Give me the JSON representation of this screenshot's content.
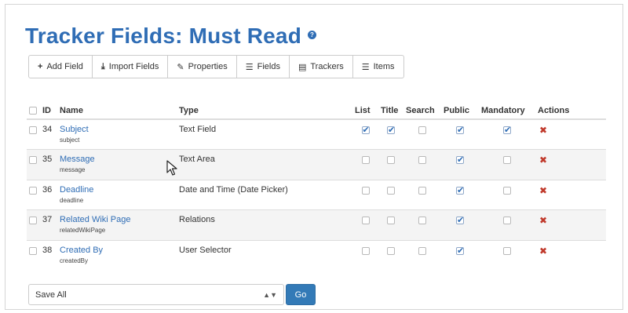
{
  "page": {
    "title": "Tracker Fields: Must Read",
    "help_icon": "?"
  },
  "toolbar": {
    "buttons": [
      {
        "label": "Add Field",
        "icon": "plus-icon",
        "glyph": "+"
      },
      {
        "label": "Import Fields",
        "icon": "import-icon",
        "glyph": "⤓"
      },
      {
        "label": "Properties",
        "icon": "wrench-icon",
        "glyph": "✎"
      },
      {
        "label": "Fields",
        "icon": "list-icon",
        "glyph": "☰"
      },
      {
        "label": "Trackers",
        "icon": "database-icon",
        "glyph": "▤"
      },
      {
        "label": "Items",
        "icon": "list-icon",
        "glyph": "☰"
      }
    ]
  },
  "table": {
    "headers": {
      "id": "ID",
      "name": "Name",
      "type": "Type",
      "list": "List",
      "title": "Title",
      "search": "Search",
      "public": "Public",
      "mandatory": "Mandatory",
      "actions": "Actions"
    },
    "rows": [
      {
        "id": "34",
        "name": "Subject",
        "perm": "subject",
        "type": "Text Field",
        "list": true,
        "title": true,
        "search": false,
        "public": true,
        "mandatory": true
      },
      {
        "id": "35",
        "name": "Message",
        "perm": "message",
        "type": "Text Area",
        "list": false,
        "title": false,
        "search": false,
        "public": true,
        "mandatory": false
      },
      {
        "id": "36",
        "name": "Deadline",
        "perm": "deadline",
        "type": "Date and Time (Date Picker)",
        "list": false,
        "title": false,
        "search": false,
        "public": true,
        "mandatory": false
      },
      {
        "id": "37",
        "name": "Related Wiki Page",
        "perm": "relatedWikiPage",
        "type": "Relations",
        "list": false,
        "title": false,
        "search": false,
        "public": true,
        "mandatory": false
      },
      {
        "id": "38",
        "name": "Created By",
        "perm": "createdBy",
        "type": "User Selector",
        "list": false,
        "title": false,
        "search": false,
        "public": true,
        "mandatory": false
      }
    ],
    "delete_glyph": "✖"
  },
  "footer": {
    "bulk_action": "Save All",
    "go_label": "Go"
  },
  "colors": {
    "accent": "#2f6db5",
    "delete": "#c0392b",
    "go_button": "#337ab7"
  }
}
